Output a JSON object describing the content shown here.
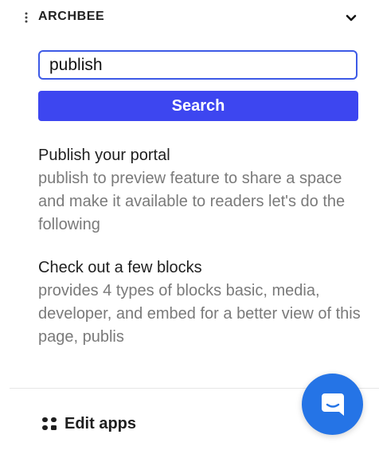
{
  "header": {
    "app_name": "ARCHBEE",
    "handle_icon": "vertical-dots-icon",
    "collapse_icon": "chevron-down-icon"
  },
  "search": {
    "value": "publish",
    "button_label": "Search"
  },
  "results": [
    {
      "title": "Publish your portal",
      "snippet": "publish to preview feature to share a space and make it available to readers let's do the following"
    },
    {
      "title": "Check out a few blocks",
      "snippet": "provides 4 types of blocks basic, media, developer, and embed for a better view of this page, publis"
    }
  ],
  "footer": {
    "edit_apps_label": "Edit apps",
    "edit_apps_icon": "apps-grid-icon"
  },
  "chat": {
    "icon": "chat-bubble-icon"
  },
  "colors": {
    "accent": "#3d46f0",
    "input_border": "#3d5ae6",
    "chat_launcher": "#2574e6",
    "snippet_text": "#7a7a7a"
  }
}
